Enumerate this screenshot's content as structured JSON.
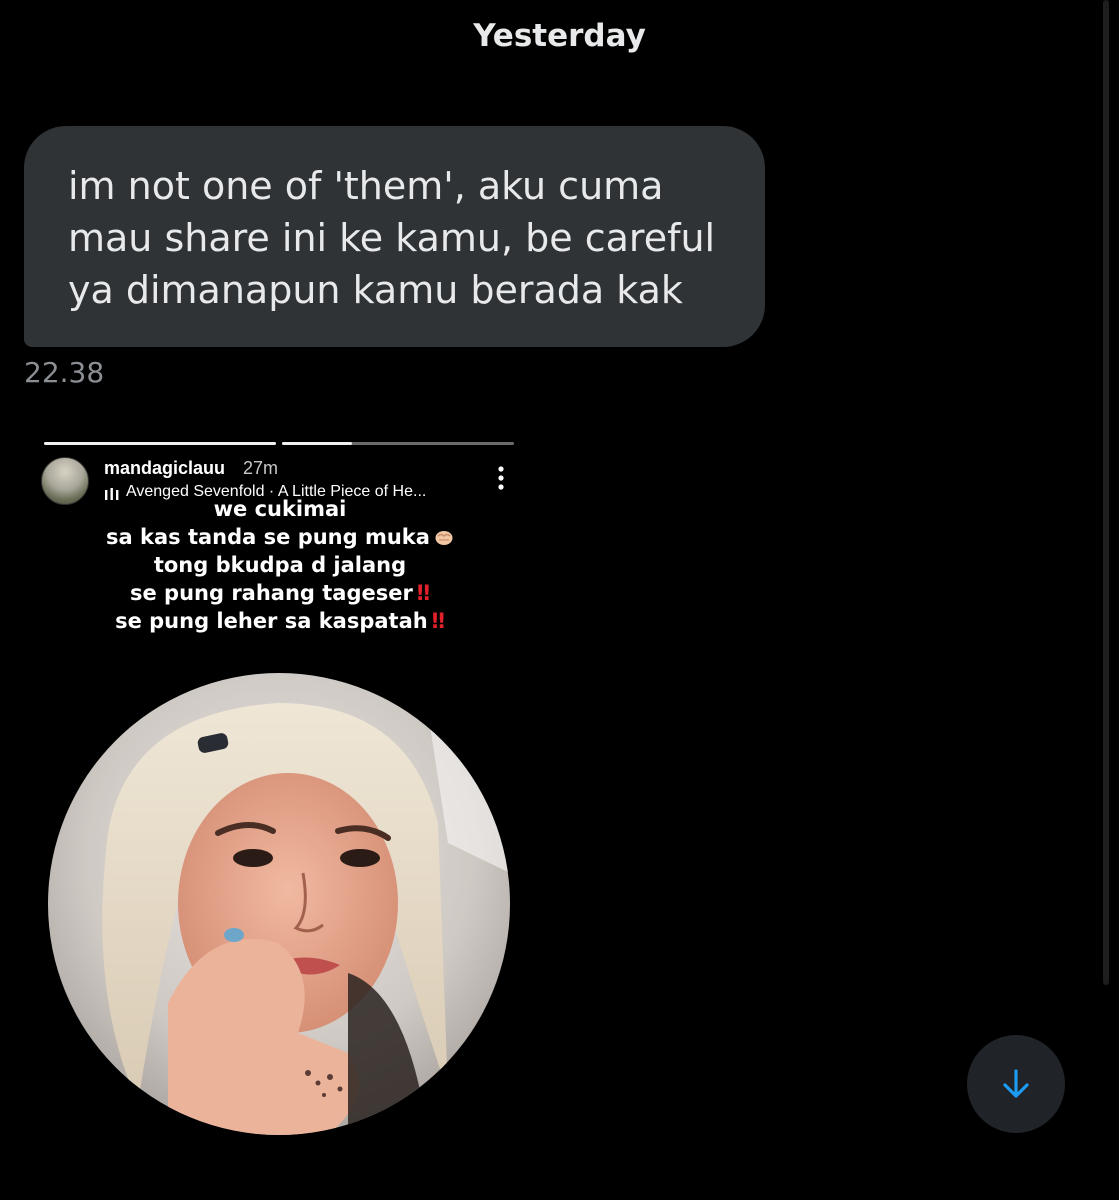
{
  "conversation": {
    "date_separator": "Yesterday",
    "message": {
      "lines": [
        "im not one of 'them', aku cuma",
        "mau share ini ke kamu, be careful",
        "ya dimanapun kamu berada kak"
      ],
      "timestamp": "22.38"
    }
  },
  "story": {
    "progress": [
      1.0,
      0.3
    ],
    "username": "mandagiclauu",
    "time_ago": "27m",
    "music": "Avenged Sevenfold · A Little Piece of He...",
    "caption": {
      "line1": "we cukimai",
      "line2": "sa kas tanda se pung muka",
      "line3": "tong bkudpa d jalang",
      "line4": "se pung rahang tageser",
      "line5": "se pung leher sa kaspatah",
      "bang": "‼"
    },
    "icons": {
      "music": "music-bars-icon",
      "menu": "more-vertical-icon",
      "emoji": "fist-emoji"
    }
  },
  "controls": {
    "scroll_button_icon": "arrow-down-icon",
    "accent_color": "#1d9bf0"
  }
}
